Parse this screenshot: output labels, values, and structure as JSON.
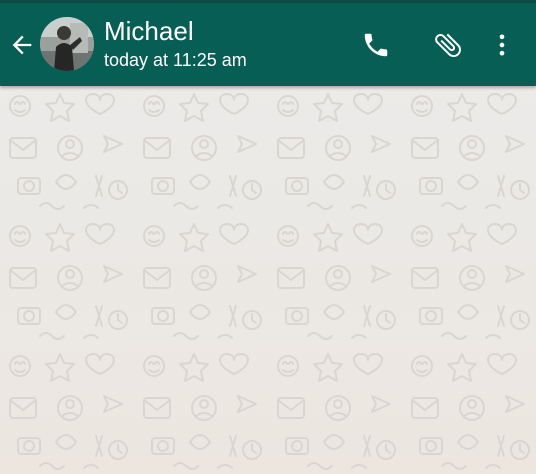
{
  "header": {
    "contact_name": "Michael",
    "last_seen": "today at 11:25 am"
  },
  "icons": {
    "back": "arrow-left-icon",
    "avatar": "contact-photo",
    "call": "phone-icon",
    "attach": "paperclip-icon",
    "menu": "more-vertical-icon"
  },
  "colors": {
    "toolbar": "#075e54",
    "status_bar": "#0d4a43",
    "chat_background": "#ebe9e6",
    "doodle": "#d9d6d1",
    "header_text": "#ffffff"
  }
}
